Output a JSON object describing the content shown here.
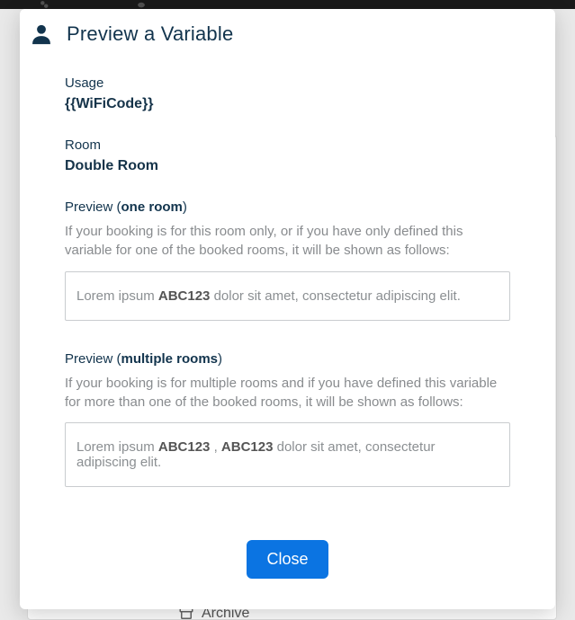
{
  "modal": {
    "title": "Preview a Variable",
    "usage": {
      "label": "Usage",
      "value": "{{WiFiCode}}"
    },
    "room": {
      "label": "Room",
      "value": "Double Room"
    },
    "preview_one": {
      "label_prefix": "Preview (",
      "label_em": "one room",
      "label_suffix": ")",
      "explain": "If your booking is for this room only, or if you have only defined this variable for one of the booked rooms, it will be shown as follows:",
      "sample_before": "Lorem ipsum ",
      "sample_code": "ABC123",
      "sample_after": " dolor sit amet, consectetur adipiscing elit."
    },
    "preview_multi": {
      "label_prefix": "Preview (",
      "label_em": "multiple rooms",
      "label_suffix": ")",
      "explain": "If your booking is for multiple rooms and if you have defined this variable for more than one of the booked rooms, it will be shown as follows:",
      "sample_before": "Lorem ipsum ",
      "sample_code1": "ABC123",
      "sample_sep": " , ",
      "sample_code2": "ABC123",
      "sample_after": " dolor sit amet, consectetur adipiscing elit."
    },
    "close_label": "Close"
  },
  "background": {
    "archive_label": "Archive"
  }
}
